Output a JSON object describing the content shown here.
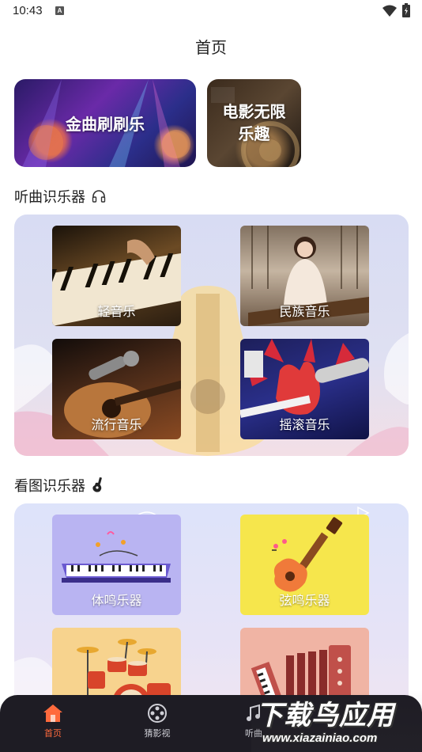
{
  "status_bar": {
    "time": "10:43",
    "notification_icon": "A",
    "wifi_icon": "wifi-icon",
    "battery_icon": "battery-icon"
  },
  "page": {
    "title": "首页"
  },
  "banners": [
    {
      "label": "金曲刷刷乐"
    },
    {
      "label_line1": "电影无限",
      "label_line2": "乐趣"
    }
  ],
  "section_listen": {
    "title": "听曲识乐器",
    "icon": "headphones-icon",
    "tiles": [
      {
        "label": "轻音乐"
      },
      {
        "label": "民族音乐"
      },
      {
        "label": "流行音乐"
      },
      {
        "label": "摇滚音乐"
      }
    ]
  },
  "section_look": {
    "title": "看图识乐器",
    "icon": "guitar-icon",
    "tiles": [
      {
        "label": "体鸣乐器"
      },
      {
        "label": "弦鸣乐器"
      },
      {
        "label": ""
      },
      {
        "label": ""
      }
    ]
  },
  "bottom_nav": {
    "items": [
      {
        "label": "首页",
        "icon": "home-icon",
        "active": true
      },
      {
        "label": "猜影视",
        "icon": "film-reel-icon",
        "active": false
      },
      {
        "label": "听曲",
        "icon": "music-icon",
        "active": false
      }
    ],
    "active_color": "#ff6a3d"
  },
  "watermark": {
    "title": "下载鸟应用",
    "url": "www.xiazainiao.com"
  }
}
